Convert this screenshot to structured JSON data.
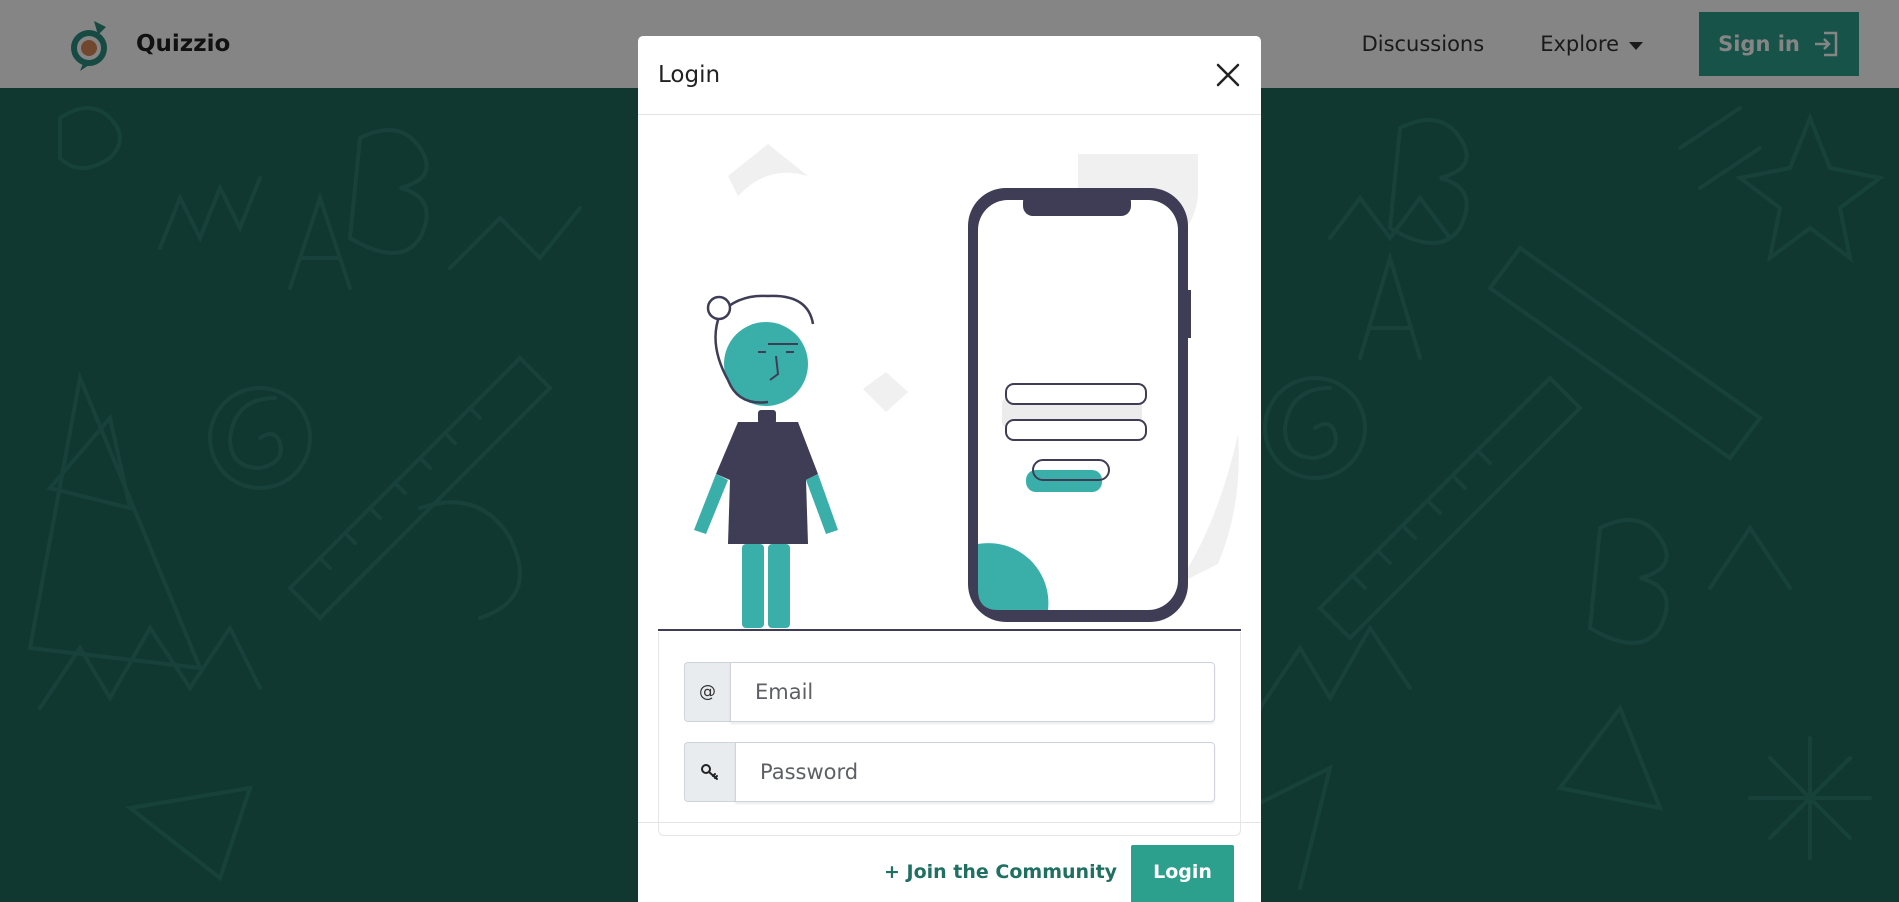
{
  "navbar": {
    "brand_name": "Quizzio",
    "links": [
      {
        "label": "Discussions"
      },
      {
        "label": "Explore"
      }
    ],
    "signin_label": "Sign in"
  },
  "modal": {
    "title": "Login",
    "email": {
      "icon_glyph": "@",
      "placeholder": "Email",
      "value": ""
    },
    "password": {
      "icon_glyph": "key",
      "placeholder": "Password",
      "value": ""
    },
    "join_label": "+ Join the Community",
    "login_label": "Login"
  },
  "colors": {
    "accent": "#2d9f8d",
    "background": "#1f6b5f",
    "illustration_accent": "#3aafa9",
    "illustration_dark": "#3f3d56"
  },
  "icons": [
    "quizzio-logo-icon",
    "chevron-down-icon",
    "sign-in-icon",
    "close-icon",
    "at-icon",
    "key-icon"
  ]
}
